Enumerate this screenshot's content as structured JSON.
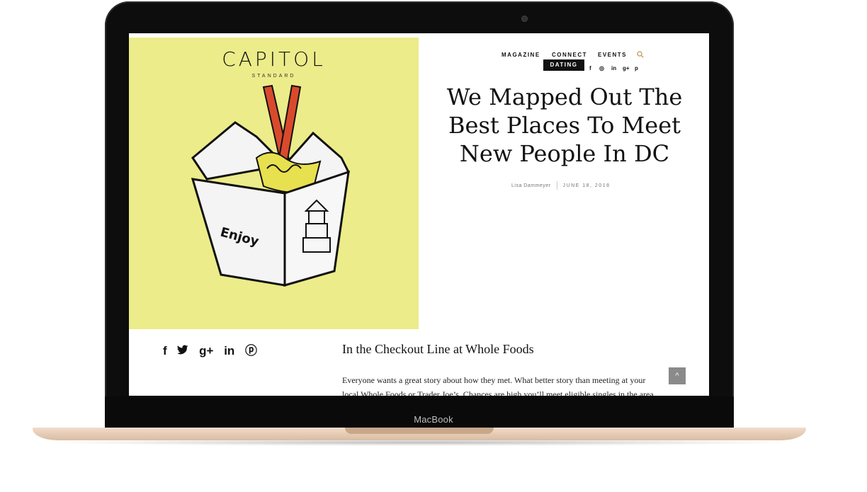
{
  "device": {
    "brand_label": "MacBook"
  },
  "site": {
    "logo": "CAPITOL",
    "logo_sub": "STANDARD",
    "nav": {
      "items": [
        "MAGAZINE",
        "CONNECT",
        "EVENTS"
      ],
      "active_sub": "DATING",
      "search_icon": "search-icon"
    },
    "top_social": [
      "f",
      "◎",
      "in",
      "g+",
      "p"
    ]
  },
  "article": {
    "title_lines": [
      "We Mapped Out The",
      "Best Places To Meet",
      "New People In DC"
    ],
    "author": "Lisa Dammeyer",
    "date": "JUNE 18, 2018",
    "section_heading": "In the Checkout Line at Whole Foods",
    "body_lines": [
      "Everyone wants a great story about how they met. What better story than meeting at your",
      "local Whole Foods or Trader Joe’s. Chances are high you’ll meet eligible singles in the area"
    ]
  },
  "share": {
    "icons": [
      "f",
      "🐦",
      "g+",
      "in",
      "ⓟ"
    ]
  },
  "back_to_top": "^",
  "colors": {
    "hero_bg": "#ecec8a",
    "accent_search": "#c8a66c"
  }
}
